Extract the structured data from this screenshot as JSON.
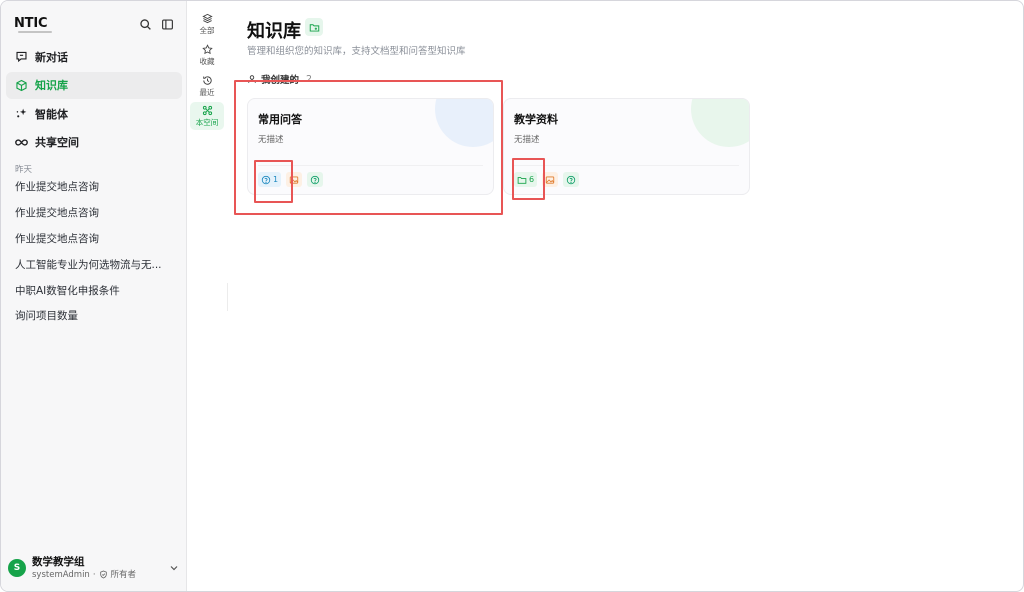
{
  "app": {
    "logo_text": "NTIC"
  },
  "sidebar": {
    "nav": [
      {
        "label": "新对话",
        "icon": "chat-icon"
      },
      {
        "label": "知识库",
        "icon": "cube-icon",
        "active": true
      },
      {
        "label": "智能体",
        "icon": "sparkle-icon"
      },
      {
        "label": "共享空间",
        "icon": "infinity-icon"
      }
    ],
    "history_section_label": "昨天",
    "history": [
      "作业提交地点咨询",
      "作业提交地点咨询",
      "作业提交地点咨询",
      "人工智能专业为何选物流与无...",
      "中职AI数智化申报条件",
      "询问项目数量"
    ],
    "user": {
      "avatar_letter": "S",
      "name": "数学教学组",
      "account": "systemAdmin",
      "separator": "·",
      "role": "所有者"
    }
  },
  "rail": [
    {
      "label": "全部",
      "icon": "layers-icon"
    },
    {
      "label": "收藏",
      "icon": "star-icon"
    },
    {
      "label": "最近",
      "icon": "history-icon"
    },
    {
      "label": "本空间",
      "icon": "network-icon",
      "active": true
    }
  ],
  "main": {
    "title": "知识库",
    "subtitle": "管理和组织您的知识库，支持文档型和问答型知识库",
    "tab": {
      "label": "我创建的",
      "count": "2"
    },
    "cards": [
      {
        "title": "常用问答",
        "description": "无描述",
        "type_count": "1",
        "type": "qa",
        "accent": "#e5f2fb"
      },
      {
        "title": "教学资料",
        "description": "无描述",
        "type_count": "6",
        "type": "document",
        "accent": "#e6f6ec"
      }
    ]
  },
  "colors": {
    "brand_green": "#16a34a",
    "highlight_red": "#e85555"
  }
}
